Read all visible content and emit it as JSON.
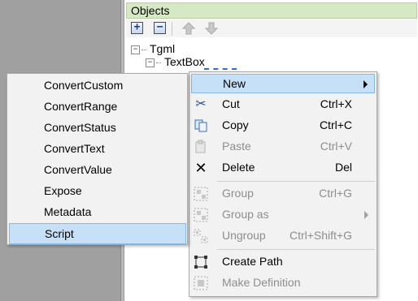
{
  "objects_panel": {
    "title": "Objects",
    "toolbar": {
      "expand_label": "+",
      "collapse_label": "−"
    },
    "tree": {
      "root": {
        "label": "Tgml",
        "expander": "⊟"
      },
      "child": {
        "label": "TextBox",
        "expander": "⊟"
      }
    }
  },
  "context_menu": {
    "items": [
      {
        "label": "New",
        "shortcut": "",
        "icon": "none",
        "enabled": true,
        "submenu": true,
        "highlighted": true
      },
      {
        "label": "Cut",
        "shortcut": "Ctrl+X",
        "icon": "scissors-icon",
        "enabled": true
      },
      {
        "label": "Copy",
        "shortcut": "Ctrl+C",
        "icon": "copy-icon",
        "enabled": true
      },
      {
        "label": "Paste",
        "shortcut": "Ctrl+V",
        "icon": "paste-icon",
        "enabled": false
      },
      {
        "label": "Delete",
        "shortcut": "Del",
        "icon": "delete-x-icon",
        "enabled": true
      },
      {
        "label": "Group",
        "shortcut": "Ctrl+G",
        "icon": "group-icon",
        "enabled": false
      },
      {
        "label": "Group as",
        "shortcut": "",
        "icon": "group-as-icon",
        "enabled": false,
        "submenu": true
      },
      {
        "label": "Ungroup",
        "shortcut": "Ctrl+Shift+G",
        "icon": "ungroup-icon",
        "enabled": false
      },
      {
        "label": "Create Path",
        "shortcut": "",
        "icon": "create-path-icon",
        "enabled": true
      },
      {
        "label": "Make Definition",
        "shortcut": "",
        "icon": "make-definition-icon",
        "enabled": false
      }
    ]
  },
  "new_submenu": {
    "items": [
      {
        "label": "ConvertCustom"
      },
      {
        "label": "ConvertRange"
      },
      {
        "label": "ConvertStatus"
      },
      {
        "label": "ConvertText"
      },
      {
        "label": "ConvertValue"
      },
      {
        "label": "Expose"
      },
      {
        "label": "Metadata"
      },
      {
        "label": "Script",
        "highlighted": true
      }
    ]
  },
  "colors": {
    "header_bg": "#d6e8c4",
    "highlight_bg": "#c5e0f7",
    "highlight_border": "#86b9e6",
    "left_pane_bg": "#a0a0a0"
  }
}
